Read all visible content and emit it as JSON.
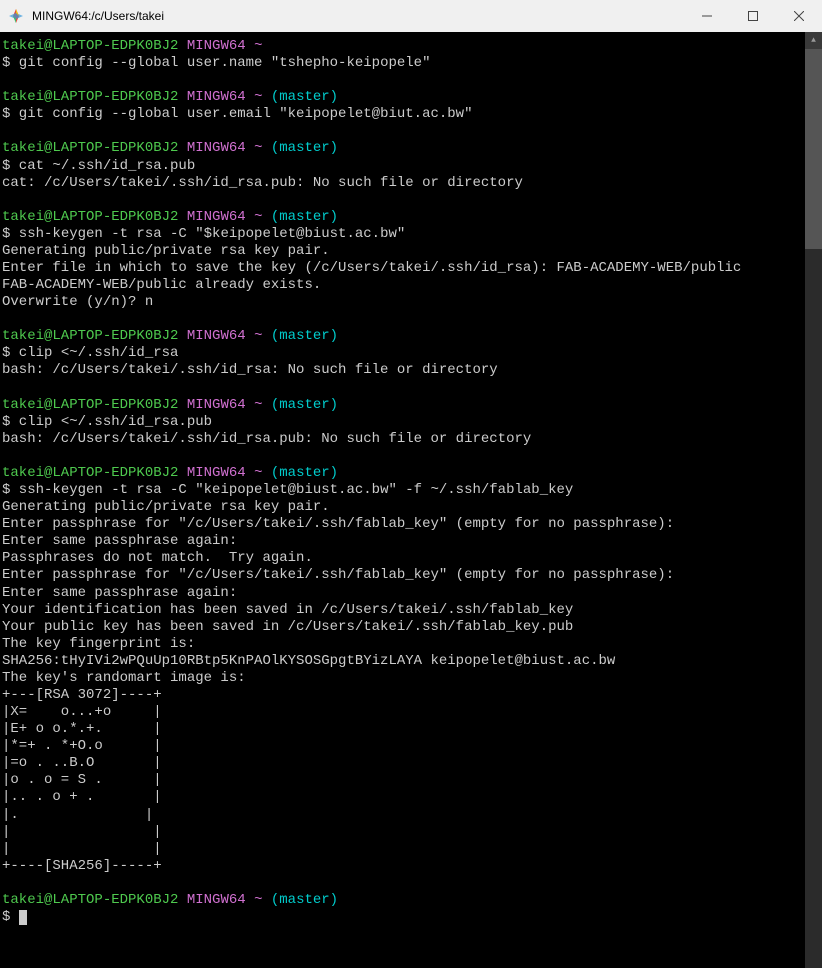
{
  "window": {
    "title": "MINGW64:/c/Users/takei"
  },
  "prompt": {
    "user": "takei@LAPTOP-EDPK0BJ2",
    "shell": "MINGW64",
    "tilde": "~",
    "branch": "(master)",
    "symbol": "$"
  },
  "blocks": [
    {
      "cmd": " git config --global user.name \"tshepho-keipopele\"",
      "show_branch": false,
      "out": []
    },
    {
      "cmd": " git config --global user.email \"keipopelet@biut.ac.bw\"",
      "show_branch": true,
      "out": []
    },
    {
      "cmd": " cat ~/.ssh/id_rsa.pub",
      "show_branch": true,
      "out": [
        "cat: /c/Users/takei/.ssh/id_rsa.pub: No such file or directory"
      ]
    },
    {
      "cmd": " ssh-keygen -t rsa -C \"$keipopelet@biust.ac.bw\"",
      "show_branch": true,
      "out": [
        "Generating public/private rsa key pair.",
        "Enter file in which to save the key (/c/Users/takei/.ssh/id_rsa): FAB-ACADEMY-WEB/public",
        "FAB-ACADEMY-WEB/public already exists.",
        "Overwrite (y/n)? n"
      ]
    },
    {
      "cmd": " clip <~/.ssh/id_rsa",
      "show_branch": true,
      "out": [
        "bash: /c/Users/takei/.ssh/id_rsa: No such file or directory"
      ]
    },
    {
      "cmd": " clip <~/.ssh/id_rsa.pub",
      "show_branch": true,
      "out": [
        "bash: /c/Users/takei/.ssh/id_rsa.pub: No such file or directory"
      ]
    },
    {
      "cmd": " ssh-keygen -t rsa -C \"keipopelet@biust.ac.bw\" -f ~/.ssh/fablab_key",
      "show_branch": true,
      "out": [
        "Generating public/private rsa key pair.",
        "Enter passphrase for \"/c/Users/takei/.ssh/fablab_key\" (empty for no passphrase):",
        "Enter same passphrase again:",
        "Passphrases do not match.  Try again.",
        "Enter passphrase for \"/c/Users/takei/.ssh/fablab_key\" (empty for no passphrase):",
        "Enter same passphrase again:",
        "Your identification has been saved in /c/Users/takei/.ssh/fablab_key",
        "Your public key has been saved in /c/Users/takei/.ssh/fablab_key.pub",
        "The key fingerprint is:",
        "SHA256:tHyIVi2wPQuUp10RBtp5KnPAOlKYSOSGpgtBYizLAYA keipopelet@biust.ac.bw",
        "The key's randomart image is:",
        "+---[RSA 3072]----+",
        "|X=    o...+o     |",
        "|E+ o o.*.+.      |",
        "|*=+ . *+O.o      |",
        "|=o . ..B.O       |",
        "|o . o = S .      |",
        "|.. . o + .       |",
        "|.               |",
        "|                 |",
        "|                 |",
        "+----[SHA256]-----+"
      ]
    },
    {
      "cmd": "",
      "show_branch": true,
      "out": [],
      "current": true
    }
  ]
}
